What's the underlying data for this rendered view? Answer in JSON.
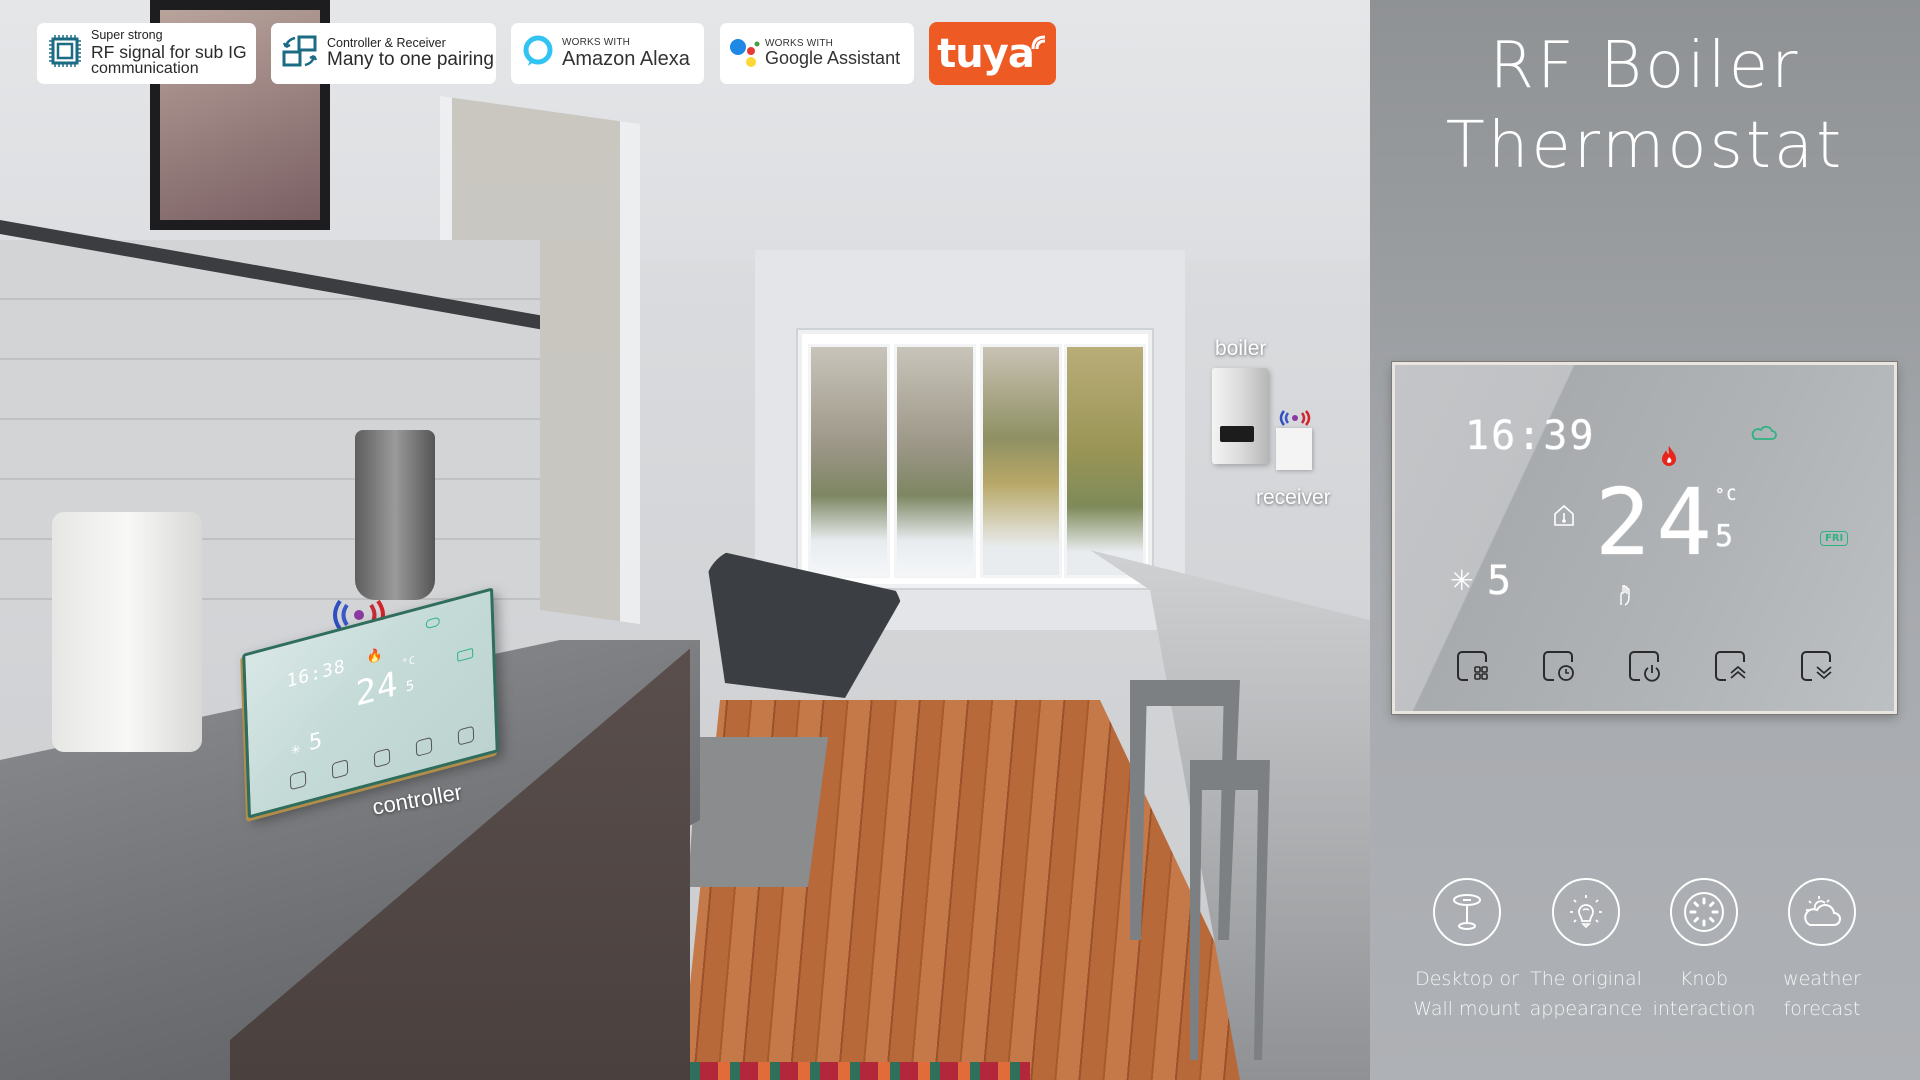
{
  "badges": [
    {
      "icon": "rf-chip-icon",
      "small": "Super strong",
      "line1": "RF signal for sub IG",
      "line2": "communication"
    },
    {
      "icon": "pairing-icon",
      "small": "Controller & Receiver",
      "line1": "Many to one pairing"
    },
    {
      "icon": "alexa-icon",
      "small": "WORKS WITH",
      "line1": "Amazon Alexa"
    },
    {
      "icon": "google-assistant-icon",
      "small": "WORKS WITH",
      "line1": "Google Assistant"
    },
    {
      "icon": "tuya-logo",
      "line1": "tuya"
    }
  ],
  "colors": {
    "tuya_orange": "#ee5a24",
    "alexa_blue": "#31c4f3",
    "badge_icon_teal": "#1a6b83",
    "flame_red": "#e8241c",
    "display_green": "#2fb381",
    "rf_blue": "#2d4fbf",
    "rf_red": "#d4232b"
  },
  "scene": {
    "labels": {
      "boiler": "boiler",
      "receiver": "receiver",
      "controller": "controller"
    }
  },
  "mini_controller": {
    "time": "16:38",
    "temp": "24",
    "temp_decimal": "5",
    "unit": "°C",
    "setpoint": "5"
  },
  "product": {
    "title_line1": "RF Boiler",
    "title_line2": "Thermostat"
  },
  "thermostat": {
    "time": "16:39",
    "temperature": "24",
    "temperature_decimal": "5",
    "unit": "°C",
    "setpoint_value": "5",
    "day": "FRI",
    "status_icons": [
      "flame-icon",
      "weather-cloud-icon",
      "home-temperature-icon",
      "snowflake-icon",
      "hand-touch-icon"
    ],
    "buttons": [
      {
        "name": "menu-button",
        "icon": "grid-icon"
      },
      {
        "name": "schedule-button",
        "icon": "clock-icon"
      },
      {
        "name": "power-button",
        "icon": "power-icon"
      },
      {
        "name": "up-button",
        "icon": "chevron-up-icon"
      },
      {
        "name": "down-button",
        "icon": "chevron-down-icon"
      }
    ]
  },
  "features": [
    {
      "icon": "desktop-stand-icon",
      "line1": "Desktop or",
      "line2": "Wall mount"
    },
    {
      "icon": "lightbulb-icon",
      "line1": "The original",
      "line2": "appearance"
    },
    {
      "icon": "knob-icon",
      "line1": "Knob",
      "line2": "interaction"
    },
    {
      "icon": "weather-icon",
      "line1": "weather",
      "line2": "forecast"
    }
  ]
}
